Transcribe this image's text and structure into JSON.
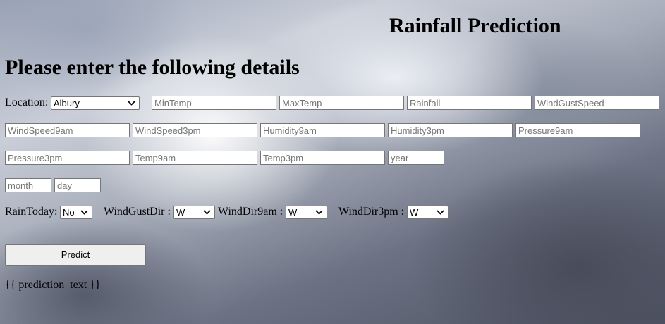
{
  "header": {
    "title": "Rainfall Prediction",
    "subtitle": "Please enter the following details"
  },
  "form": {
    "location": {
      "label": "Location:",
      "selected": "Albury"
    },
    "fields": {
      "min_temp": "MinTemp",
      "max_temp": "MaxTemp",
      "rainfall": "Rainfall",
      "wind_gust_speed": "WindGustSpeed",
      "wind_speed_9am": "WindSpeed9am",
      "wind_speed_3pm": "WindSpeed3pm",
      "humidity_9am": "Humidity9am",
      "humidity_3pm": "Humidity3pm",
      "pressure_9am": "Pressure9am",
      "pressure_3pm": "Pressure3pm",
      "temp_9am": "Temp9am",
      "temp_3pm": "Temp3pm",
      "year": "year",
      "month": "month",
      "day": "day"
    },
    "rain_today": {
      "label": "RainToday:",
      "selected": "No"
    },
    "wind_gust_dir": {
      "label": "WindGustDir :",
      "selected": "W"
    },
    "wind_dir_9am": {
      "label": "WindDir9am :",
      "selected": "W"
    },
    "wind_dir_3pm": {
      "label": "WindDir3pm :",
      "selected": "W"
    },
    "predict_label": "Predict"
  },
  "result": {
    "text": "{{ prediction_text }}"
  }
}
